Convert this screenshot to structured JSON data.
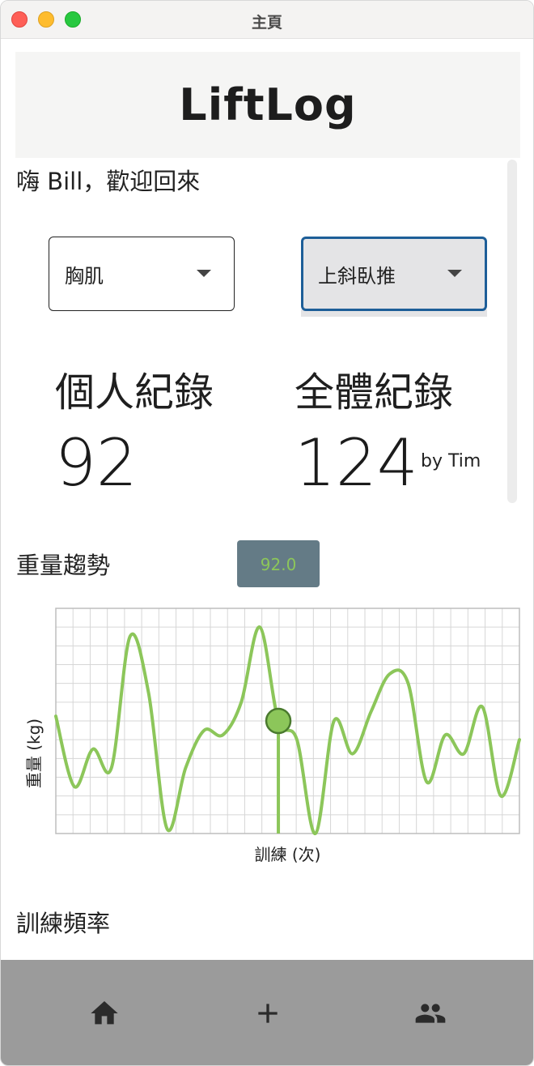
{
  "window": {
    "title": "主頁"
  },
  "header": {
    "logo": "LiftLog"
  },
  "greeting": "嗨 Bill，歡迎回來",
  "filters": {
    "muscle": {
      "selected": "胸肌"
    },
    "exercise": {
      "selected": "上斜臥推"
    }
  },
  "records": {
    "personal": {
      "title": "個人紀錄",
      "value": "92"
    },
    "global": {
      "title": "全體紀錄",
      "value": "124",
      "by": "by Tim"
    }
  },
  "sections": {
    "weight_trend": "重量趨勢",
    "training_frequency": "訓練頻率"
  },
  "chart_data": {
    "type": "line",
    "xlabel": "訓練 (次)",
    "ylabel": "重量 (kg)",
    "grid": true,
    "y_range_estimated": [
      70,
      94
    ],
    "x": [
      0,
      1,
      2,
      3,
      4,
      5,
      6,
      7,
      8,
      9,
      10,
      11,
      12,
      13,
      14,
      15,
      16,
      17,
      18,
      19,
      20,
      21,
      22,
      23,
      24,
      25
    ],
    "values": [
      82.5,
      75,
      79,
      77,
      91,
      85,
      70.5,
      77,
      81,
      80.5,
      84,
      92,
      82,
      80,
      70,
      82,
      78.5,
      83,
      87,
      86,
      75.5,
      80.5,
      78.5,
      83.5,
      74,
      80
    ],
    "highlight": {
      "index": 12,
      "value": "92.0"
    },
    "colors": {
      "line": "#8cc65a",
      "tooltip_bg": "#647b86",
      "grid": "#d6d6d6"
    }
  },
  "bottom_nav": {
    "items": [
      {
        "icon": "home-icon"
      },
      {
        "icon": "add-icon"
      },
      {
        "icon": "people-icon"
      }
    ]
  }
}
